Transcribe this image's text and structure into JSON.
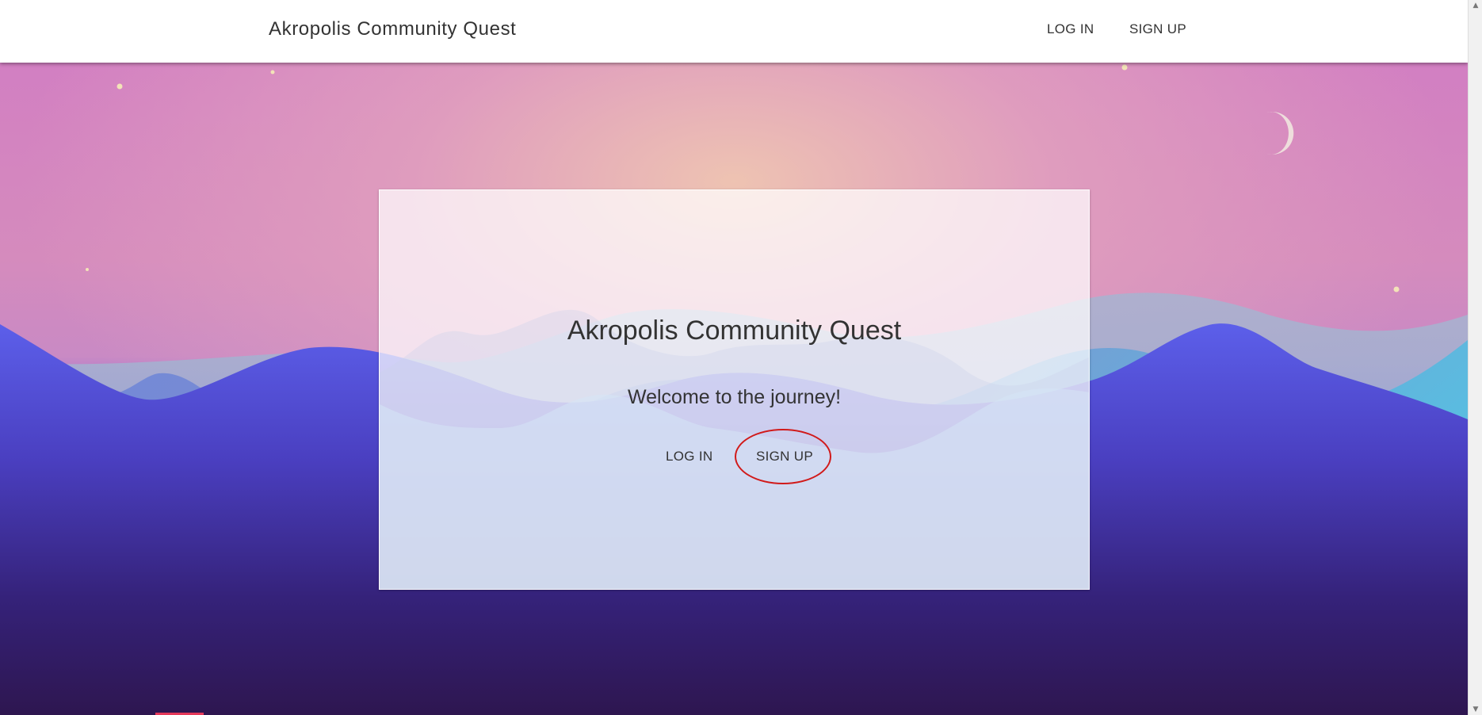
{
  "header": {
    "title": "Akropolis Community Quest",
    "nav": {
      "login_label": "LOG IN",
      "signup_label": "SIGN UP"
    }
  },
  "card": {
    "title": "Akropolis Community Quest",
    "subtitle": "Welcome to the journey!",
    "login_label": "LOG IN",
    "signup_label": "SIGN UP"
  },
  "colors": {
    "sky_top": "#d27fc2",
    "sky_glow": "#eec3b2",
    "mountain_blue": "#5b5ee8",
    "mountain_cyan": "#56b9e0",
    "ground_dark": "#2e1650",
    "highlight": "#d11a1a"
  }
}
